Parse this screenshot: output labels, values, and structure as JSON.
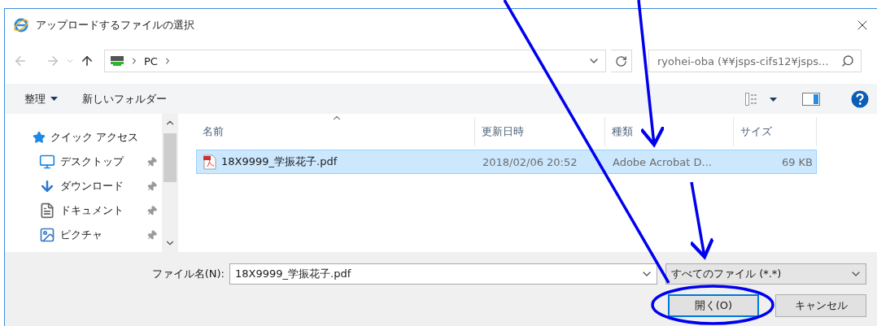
{
  "window": {
    "title": "アップロードするファイルの選択"
  },
  "address": {
    "path": [
      "PC"
    ],
    "search_placeholder": "ryohei-oba (¥¥jsps-cifs12¥jsps..."
  },
  "toolbar": {
    "organize": "整理",
    "new_folder": "新しいフォルダー"
  },
  "sidebar": {
    "items": [
      {
        "label": "クイック アクセス",
        "kind": "quick-access",
        "pinned": false
      },
      {
        "label": "デスクトップ",
        "kind": "desktop",
        "pinned": true
      },
      {
        "label": "ダウンロード",
        "kind": "downloads",
        "pinned": true
      },
      {
        "label": "ドキュメント",
        "kind": "documents",
        "pinned": true
      },
      {
        "label": "ピクチャ",
        "kind": "pictures",
        "pinned": true
      }
    ]
  },
  "table": {
    "columns": [
      {
        "label": "名前",
        "sorted": true
      },
      {
        "label": "更新日時",
        "sorted": false
      },
      {
        "label": "種類",
        "sorted": false
      },
      {
        "label": "サイズ",
        "sorted": false
      }
    ],
    "rows": [
      {
        "name": "18X9999_学振花子.pdf",
        "modified": "2018/02/06 20:52",
        "file_type": "Adobe Acrobat D...",
        "size": "69 KB",
        "selected": true
      }
    ]
  },
  "footer": {
    "filename_label": "ファイル名(N):",
    "filename_value": "18X9999_学振花子.pdf",
    "filter": "すべてのファイル (*.*)",
    "buttons": [
      {
        "label": "開く(O)",
        "default": true
      },
      {
        "label": "キャンセル",
        "default": false
      }
    ]
  }
}
